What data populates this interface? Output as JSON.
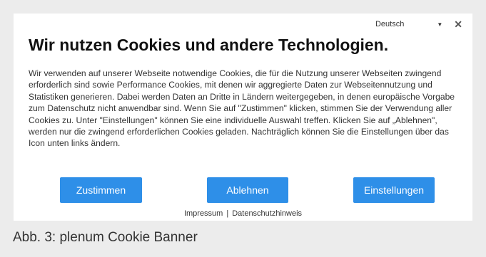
{
  "banner": {
    "language": {
      "label": "Deutsch"
    },
    "title": "Wir nutzen Cookies und andere Technologien.",
    "body": "Wir verwenden auf unserer Webseite notwendige Cookies, die für die Nutzung unserer Webseiten zwingend erforderlich sind sowie Performance Cookies, mit denen wir aggregierte Daten zur Webseitennutzung und Statistiken generieren. Dabei werden Daten an Dritte in Ländern weitergegeben, in denen europäische Vorgabe zum Datenschutz nicht anwendbar sind. Wenn Sie auf \"Zustimmen\" klicken, stimmen Sie der Verwendung aller Cookies zu. Unter \"Einstellungen\" können Sie eine individuelle Auswahl treffen. Klicken Sie auf „Ablehnen\", werden nur die zwingend erforderlichen Cookies geladen. Nachträglich können Sie die Einstellungen über das Icon unten links ändern.",
    "buttons": {
      "accept": "Zustimmen",
      "decline": "Ablehnen",
      "settings": "Einstellungen"
    },
    "links": {
      "imprint": "Impressum",
      "separator": "|",
      "privacy": "Datenschutzhinweis"
    },
    "colors": {
      "button": "#2e8fe8"
    },
    "icons": {
      "dropdown": "chevron-down-icon",
      "close": "close-icon"
    }
  },
  "caption": "Abb. 3: plenum Cookie Banner"
}
